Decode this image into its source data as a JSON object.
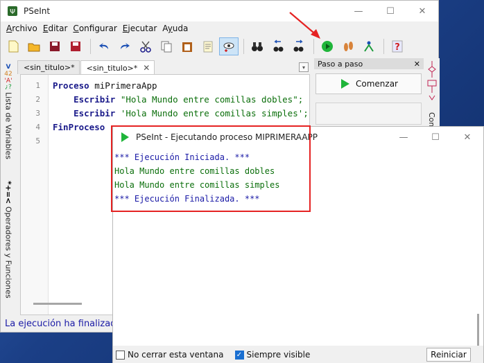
{
  "ide": {
    "title": "PSeInt",
    "menu": [
      {
        "pre": "",
        "u": "A",
        "post": "rchivo"
      },
      {
        "pre": "",
        "u": "E",
        "post": "ditar"
      },
      {
        "pre": "",
        "u": "C",
        "post": "onfigurar"
      },
      {
        "pre": "",
        "u": "E",
        "post": "jecutar"
      },
      {
        "pre": "A",
        "u": "y",
        "post": "uda"
      }
    ],
    "tabs": [
      "<sin_titulo>*",
      "<sin_titulo>*"
    ],
    "code_lines": [
      {
        "n": "1",
        "kw": "Proceso",
        "rest": " miPrimeraApp",
        "indent": ""
      },
      {
        "n": "2",
        "kw": "Escribir",
        "rest": " \"Hola Mundo entre comillas dobles\";",
        "indent": "    "
      },
      {
        "n": "3",
        "kw": "Escribir",
        "rest": " 'Hola Mundo entre comillas simples';",
        "indent": "    "
      },
      {
        "n": "4",
        "kw": "FinProceso",
        "rest": "",
        "indent": ""
      },
      {
        "n": "5",
        "kw": "",
        "rest": "",
        "indent": ""
      }
    ],
    "left_tabs": [
      "Lista de Variables",
      "Operadores y Funciones"
    ],
    "status": "La ejecución ha finalizado"
  },
  "step_panel": {
    "title": "Paso a paso",
    "button": "Comenzar",
    "right_strip": "Com"
  },
  "exec_window": {
    "title": "PSeInt - Ejecutando proceso MIPRIMERAAPP",
    "output": [
      {
        "type": "info",
        "text": "*** Ejecución Iniciada. ***"
      },
      {
        "type": "text",
        "text": "Hola Mundo entre comillas dobles"
      },
      {
        "type": "text",
        "text": "Hola Mundo entre comillas simples"
      },
      {
        "type": "info",
        "text": "*** Ejecución Finalizada. ***"
      }
    ],
    "no_close_label": "No cerrar esta ventana",
    "no_close_checked": false,
    "always_visible_label": "Siempre visible",
    "always_visible_checked": true,
    "restart_label": "Reiniciar"
  },
  "colors": {
    "keyword": "#1a1a8a",
    "string": "#0a6e0a",
    "info": "#1a1aa6",
    "highlight": "#e52222",
    "run_icon": "#1fb53a"
  }
}
